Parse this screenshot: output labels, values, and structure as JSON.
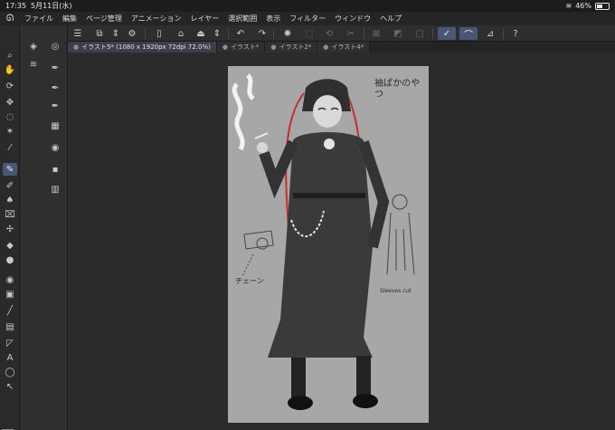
{
  "status_bar": {
    "time": "17:35",
    "date": "5月11日(水)",
    "battery": "46%",
    "battery_level": 0.46
  },
  "menu": {
    "items": [
      "ファイル",
      "編集",
      "ページ管理",
      "アニメーション",
      "レイヤー",
      "選択範囲",
      "表示",
      "フィルター",
      "ウィンドウ",
      "ヘルプ"
    ]
  },
  "tabs": [
    {
      "label": "イラスト5* (1080 x 1920px 72dpi 72.0%)",
      "active": true
    },
    {
      "label": "イラスト*",
      "active": false
    },
    {
      "label": "イラスト2*",
      "active": false
    },
    {
      "label": "イラスト4*",
      "active": false
    }
  ],
  "canvas": {
    "notes": {
      "top": "袖ぱかのやつ",
      "chain": "チェーン",
      "side": "Sleeves cut"
    }
  },
  "colors": {
    "accent": "#4a5677",
    "canvas_bg": "#a7a7a7",
    "workspace": "#2b2b2b",
    "panel": "#2e2e2e"
  },
  "icons": {
    "command_bar": [
      "menu-icon",
      "layer-move-icon",
      "chevron-updown-icon",
      "settings-icon",
      "new-file-icon",
      "open-folder-icon",
      "save-icon",
      "chevron-updown-icon",
      "undo-icon",
      "redo-icon",
      "spinner-icon",
      "transform-icon",
      "rotate-icon",
      "cut-icon",
      "crop-icon",
      "fill-icon",
      "select-all-icon",
      "pen-correction-icon",
      "brush-stroke-icon",
      "ruler-icon",
      "help-icon"
    ],
    "tools": [
      "zoom-icon",
      "hand-icon",
      "rotate-view-icon",
      "move-icon",
      "lasso-icon",
      "magic-wand-icon",
      "eyedropper-icon",
      "pen-icon",
      "pencil-icon",
      "brush-icon",
      "airbrush-icon",
      "decorate-icon",
      "eraser-icon",
      "blend-icon",
      "fill-icon",
      "gradient-icon",
      "line-icon",
      "frame-icon",
      "ruler-icon",
      "text-icon",
      "balloon-icon",
      "correct-line-icon"
    ]
  }
}
